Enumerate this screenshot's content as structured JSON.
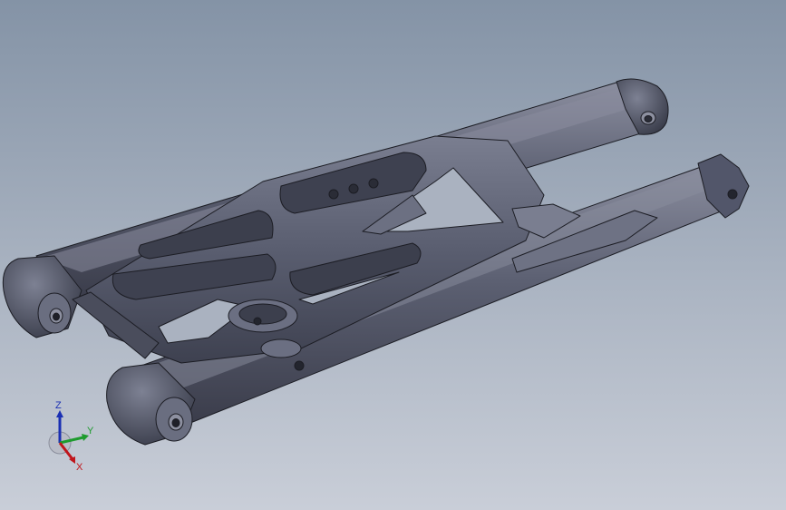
{
  "viewport": {
    "background_top": "#8493a6",
    "background_bottom": "#c9ced8"
  },
  "model": {
    "body_color": "#5a5e70",
    "dark_color": "#3c3f4d",
    "highlight_color": "#9598a8",
    "edge_color": "#1c1d24"
  },
  "triad": {
    "x_label": "X",
    "y_label": "Y",
    "z_label": "Z",
    "x_color": "#c0151b",
    "y_color": "#1e9b2e",
    "z_color": "#1a2fb3"
  }
}
